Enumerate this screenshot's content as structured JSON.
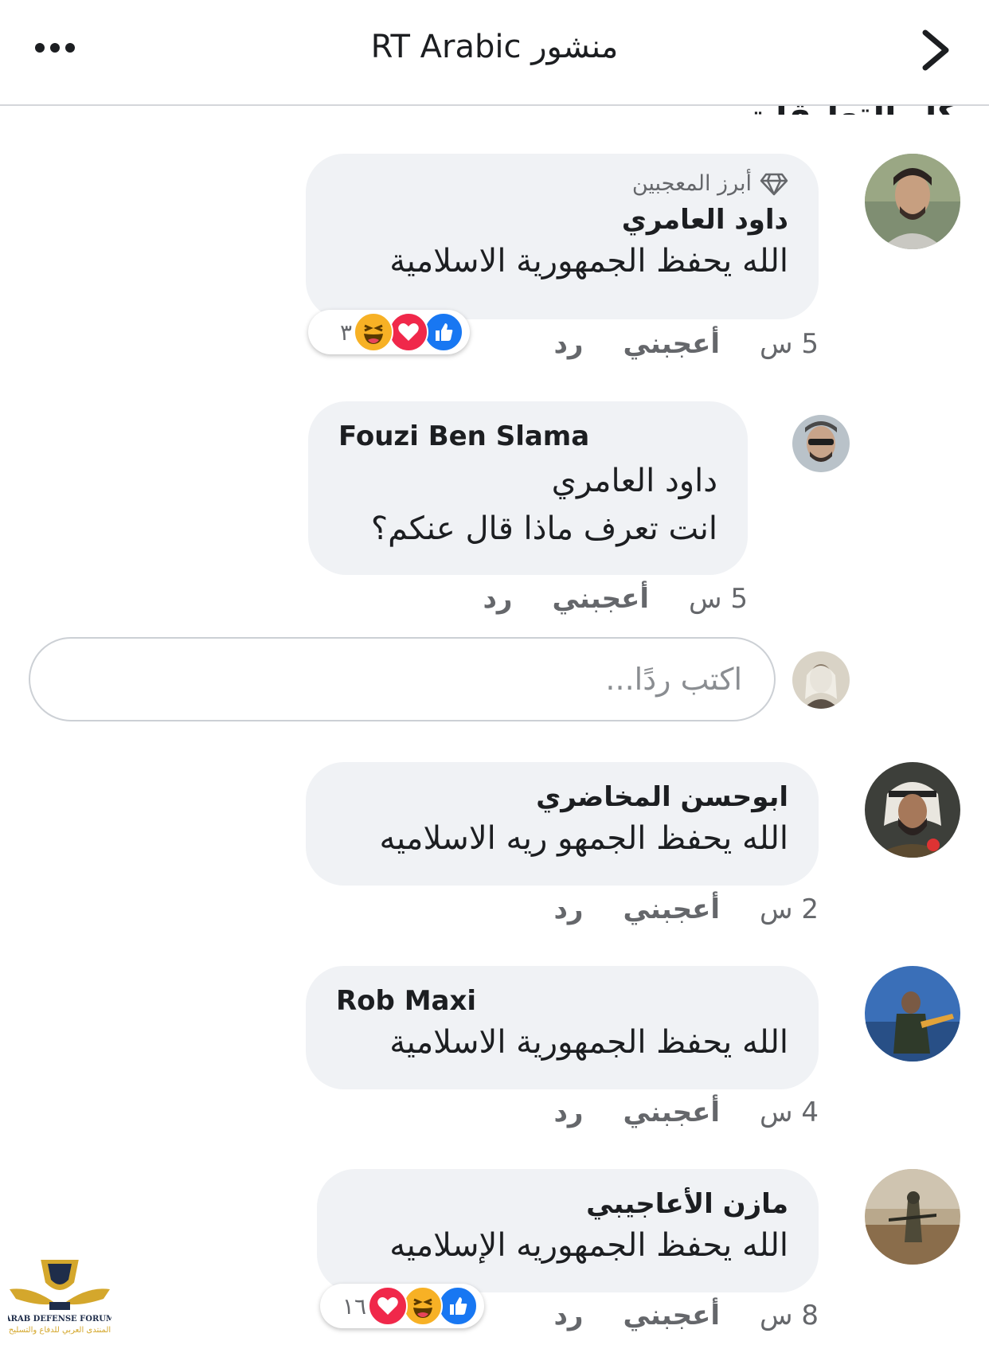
{
  "header": {
    "title": "منشور RT Arabic"
  },
  "section_heading": "كل التعليقات",
  "comments": [
    {
      "badge": "أبرز المعجبين",
      "name": "داود العامري",
      "lines": [
        "الله يحفظ الجمهورية الاسلامية"
      ],
      "time": "5 س",
      "like": "أعجبني",
      "reply": "رد",
      "reaction_count": "٣"
    },
    {
      "name": "Fouzi Ben Slama",
      "lines": [
        "داود العامري",
        "انت تعرف ماذا قال عنكم؟"
      ],
      "time": "5 س",
      "like": "أعجبني",
      "reply": "رد"
    },
    {
      "name": "ابوحسن المخاضري",
      "lines": [
        "الله يحفظ الجمهو ريه الاسلاميه"
      ],
      "time": "2 س",
      "like": "أعجبني",
      "reply": "رد"
    },
    {
      "name": "Rob Maxi",
      "lines": [
        "الله يحفظ الجمهورية الاسلامية"
      ],
      "time": "4 س",
      "like": "أعجبني",
      "reply": "رد"
    },
    {
      "name": "مازن الأعاجيبي",
      "lines": [
        "الله يحفظ الجمهوريه الإسلاميه"
      ],
      "time": "8 س",
      "like": "أعجبني",
      "reply": "رد",
      "reaction_count": "١٦"
    }
  ],
  "reply_box": {
    "placeholder": "اكتب ردًا..."
  },
  "watermark": {
    "line1": "ARAB DEFENSE FORUM",
    "line2": "المنتدى العربي للدفاع والتسليح"
  },
  "colors": {
    "bubble": "#f0f2f5",
    "secondary_text": "#65676b",
    "like_blue": "#1877f2",
    "love_red": "#f0284a",
    "haha_yellow": "#f7b125"
  }
}
